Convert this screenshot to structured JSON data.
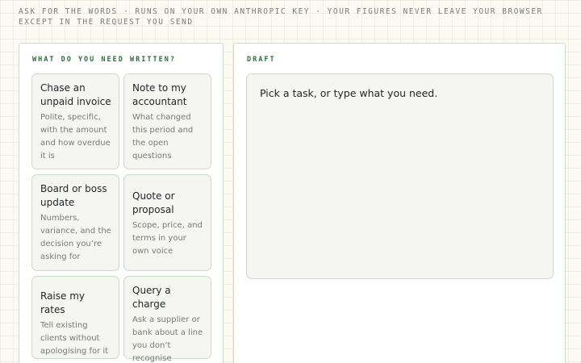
{
  "banner": "ASK FOR THE WORDS · RUNS ON YOUR OWN ANTHROPIC KEY · YOUR FIGURES NEVER LEAVE YOUR BROWSER EXCEPT IN THE REQUEST YOU SEND",
  "tasks": {
    "heading": "WHAT DO YOU NEED WRITTEN?",
    "items": [
      {
        "title": "Chase an unpaid invoice",
        "description": "Polite, specific, with the amount and how overdue it is"
      },
      {
        "title": "Note to my accountant",
        "description": "What changed this period and the open questions"
      },
      {
        "title": "Board or boss update",
        "description": "Numbers, variance, and the decision you’re asking for"
      },
      {
        "title": "Quote or proposal",
        "description": "Scope, price, and terms in your own voice"
      },
      {
        "title": "Raise my rates",
        "description": "Tell existing clients without apologising for it"
      },
      {
        "title": "Query a charge",
        "description": "Ask a supplier or bank about a line you don’t recognise"
      }
    ]
  },
  "draft": {
    "heading": "DRAFT",
    "placeholder": "Pick a task, or type what you need."
  }
}
